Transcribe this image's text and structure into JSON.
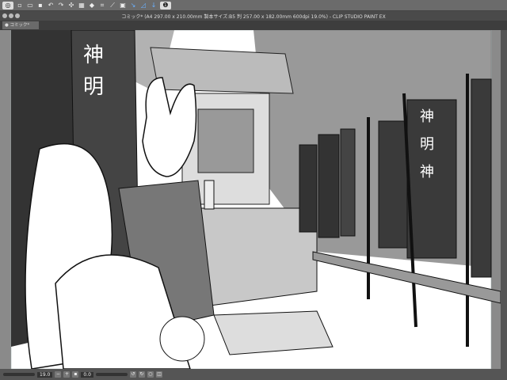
{
  "window": {
    "title": "コミック* (A4 297.00 x 210.00mm 製本サイズ:B5 判 257.00 x 182.00mm 600dpi 19.0%) - CLIP STUDIO PAINT EX",
    "tab_label": "● コミック*"
  },
  "toolbar": {
    "icons": [
      "app-menu",
      "new",
      "open",
      "save",
      "undo",
      "redo",
      "transform",
      "clear",
      "fill",
      "crop",
      "ruler",
      "snap",
      "snap-grid",
      "special-ruler",
      "help"
    ]
  },
  "canvas": {
    "banner_text": [
      "神",
      "明",
      "神"
    ]
  },
  "status": {
    "zoom": "19.0",
    "rotation": "0.0"
  }
}
